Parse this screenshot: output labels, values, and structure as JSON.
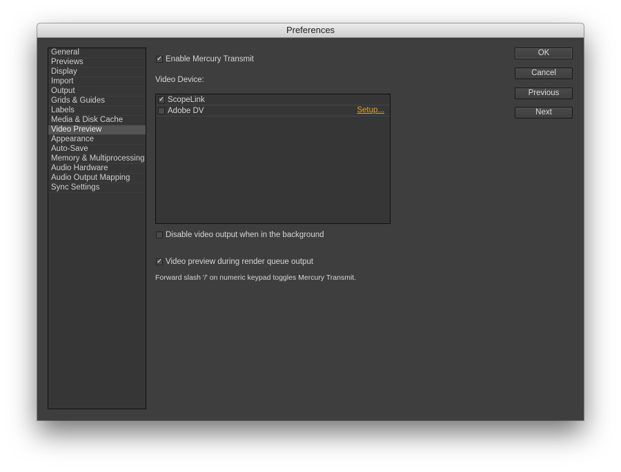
{
  "window": {
    "title": "Preferences"
  },
  "categories": [
    {
      "label": "General"
    },
    {
      "label": "Previews"
    },
    {
      "label": "Display"
    },
    {
      "label": "Import"
    },
    {
      "label": "Output"
    },
    {
      "label": "Grids & Guides"
    },
    {
      "label": "Labels"
    },
    {
      "label": "Media & Disk Cache"
    },
    {
      "label": "Video Preview",
      "selected": true
    },
    {
      "label": "Appearance"
    },
    {
      "label": "Auto-Save"
    },
    {
      "label": "Memory & Multiprocessing"
    },
    {
      "label": "Audio Hardware"
    },
    {
      "label": "Audio Output Mapping"
    },
    {
      "label": "Sync Settings"
    }
  ],
  "main": {
    "enable_mercury": {
      "label": "Enable Mercury Transmit",
      "checked": true
    },
    "video_device_label": "Video Device:",
    "devices": [
      {
        "label": "ScopeLink",
        "checked": true
      },
      {
        "label": "Adobe DV",
        "checked": false,
        "setup_label": "Setup..."
      }
    ],
    "disable_background": {
      "label": "Disable video output when in the background",
      "checked": false
    },
    "render_queue_preview": {
      "label": "Video preview during render queue output",
      "checked": true
    },
    "hint": "Forward slash '/' on numeric keypad toggles Mercury Transmit."
  },
  "buttons": {
    "ok": "OK",
    "cancel": "Cancel",
    "previous": "Previous",
    "next": "Next"
  },
  "colors": {
    "background": "#3e3e3e",
    "link": "#e8a318",
    "selected_row": "#545454"
  }
}
